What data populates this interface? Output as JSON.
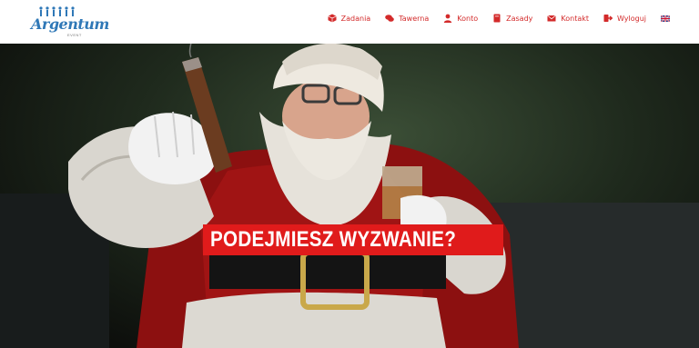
{
  "brand": {
    "name": "Argentum",
    "tagline": "EVENT"
  },
  "nav": [
    {
      "label": "Zadania",
      "icon": "cube-icon"
    },
    {
      "label": "Tawerna",
      "icon": "chat-icon"
    },
    {
      "label": "Konto",
      "icon": "user-icon"
    },
    {
      "label": "Zasady",
      "icon": "book-icon"
    },
    {
      "label": "Kontakt",
      "icon": "envelope-icon"
    },
    {
      "label": "Wyloguj",
      "icon": "logout-icon"
    },
    {
      "label": "",
      "icon": "uk-flag-icon"
    }
  ],
  "hero": {
    "headline": "PODEJMIESZ WYZWANIE?"
  },
  "colors": {
    "accent": "#d32a2a",
    "headline_bg": "#e01b1b",
    "brand_blue": "#2f78b7"
  }
}
